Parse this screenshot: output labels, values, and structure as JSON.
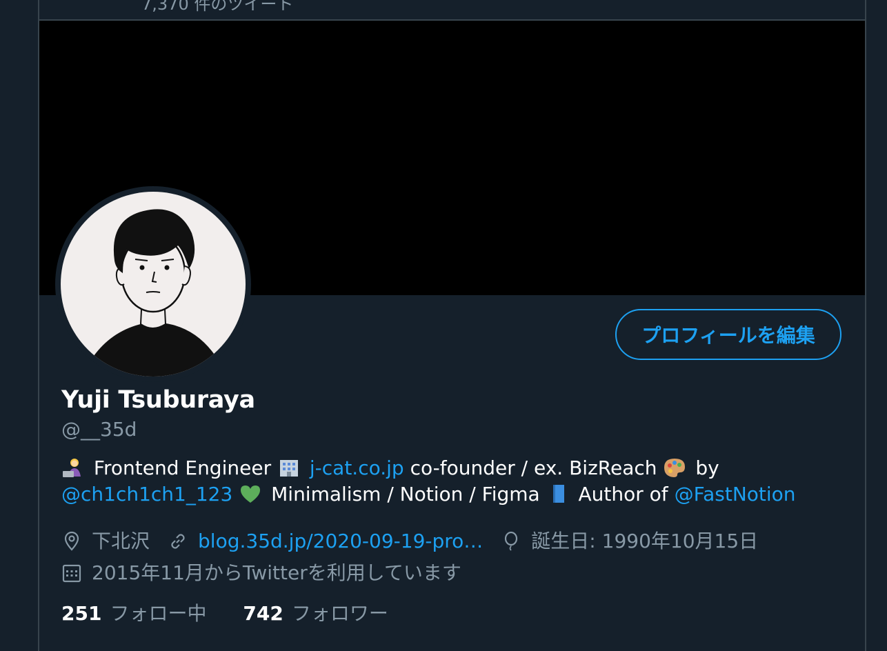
{
  "header": {
    "tweet_count_text": "7,370 件のツイート"
  },
  "profile": {
    "display_name": "Yuji Tsuburaya",
    "handle": "@__35d",
    "edit_button_label": "プロフィールを編集"
  },
  "bio": {
    "line1": {
      "text1": "Frontend Engineer",
      "link1": "j-cat.co.jp",
      "text2": "co-founder / ex. BizReach",
      "text3": "by"
    },
    "line2": {
      "link1": "@ch1ch1ch1_123",
      "text1": "Minimalism / Notion / Figma",
      "text2": "Author of",
      "link2": "@FastNotion"
    }
  },
  "meta": {
    "location": "下北沢",
    "website": "blog.35d.jp/2020-09-19-pro…",
    "birthday": "誕生日: 1990年10月15日",
    "joined": "2015年11月からTwitterを利用しています"
  },
  "stats": {
    "following_count": "251",
    "following_label": "フォロー中",
    "followers_count": "742",
    "followers_label": "フォロワー"
  },
  "colors": {
    "background": "#15202b",
    "accent": "#1da1f2",
    "secondary_text": "#8899a6",
    "border": "#38444d"
  }
}
